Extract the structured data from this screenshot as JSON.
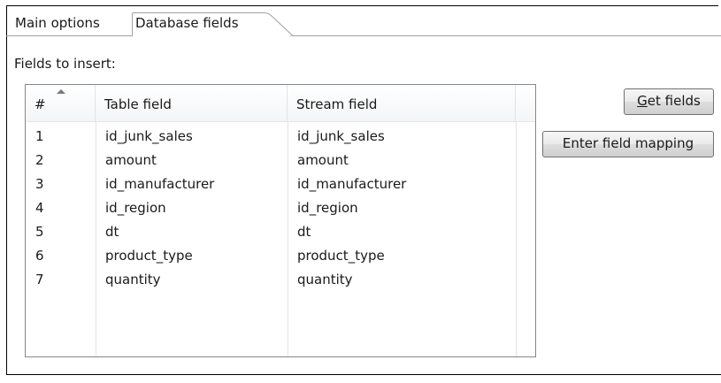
{
  "tabs": [
    {
      "label": "Main options",
      "active": false
    },
    {
      "label": "Database fields",
      "active": true
    }
  ],
  "panel": {
    "fields_label": "Fields to insert:"
  },
  "table": {
    "columns": [
      "#",
      "Table field",
      "Stream field"
    ],
    "rows": [
      {
        "num": "1",
        "table_field": "id_junk_sales",
        "stream_field": "id_junk_sales"
      },
      {
        "num": "2",
        "table_field": "amount",
        "stream_field": "amount"
      },
      {
        "num": "3",
        "table_field": "id_manufacturer",
        "stream_field": "id_manufacturer"
      },
      {
        "num": "4",
        "table_field": "id_region",
        "stream_field": "id_region"
      },
      {
        "num": "5",
        "table_field": "dt",
        "stream_field": "dt"
      },
      {
        "num": "6",
        "table_field": "product_type",
        "stream_field": "product_type"
      },
      {
        "num": "7",
        "table_field": "quantity",
        "stream_field": "quantity"
      }
    ]
  },
  "buttons": {
    "get_fields_mnemonic": "G",
    "get_fields_rest": "et fields",
    "enter_mapping": "Enter field mapping"
  }
}
